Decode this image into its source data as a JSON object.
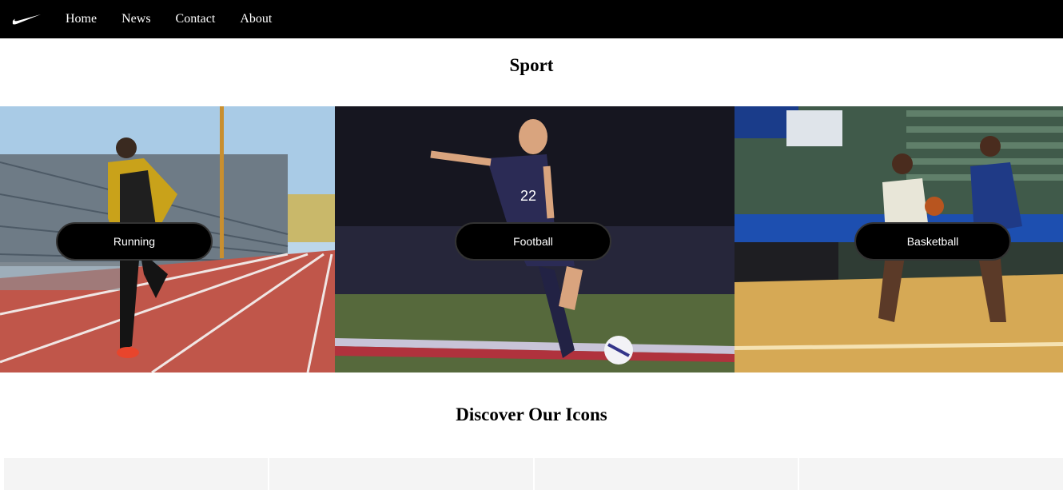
{
  "nav": {
    "logo_icon": "swoosh-logo-icon",
    "links": [
      "Home",
      "News",
      "Contact",
      "About"
    ]
  },
  "sport": {
    "title": "Sport",
    "tiles": [
      {
        "label": "Running"
      },
      {
        "label": "Football"
      },
      {
        "label": "Basketball"
      }
    ]
  },
  "discover": {
    "title": "Discover Our Icons",
    "card_count": 4
  },
  "colors": {
    "nav_bg": "#000000",
    "button_bg": "#000000",
    "card_bg": "#f4f4f4"
  }
}
